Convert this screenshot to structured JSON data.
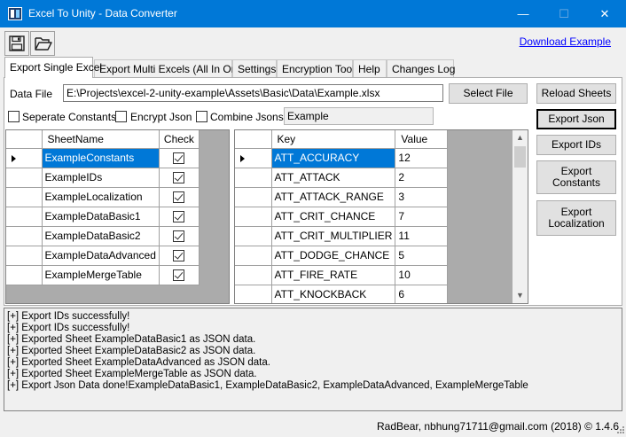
{
  "window": {
    "title": "Excel To Unity - Data Converter",
    "controls": {
      "minimize": "—",
      "maximize": "☐",
      "close": "✕"
    }
  },
  "toolbar": {
    "save_icon": "save-icon",
    "open_icon": "folder-open-icon",
    "download_link": "Download Example"
  },
  "tabs": [
    {
      "label": "Export Single Excel",
      "active": true
    },
    {
      "label": "Export Multi Excels (All In One)"
    },
    {
      "label": "Settings"
    },
    {
      "label": "Encryption Tool"
    },
    {
      "label": "Help"
    },
    {
      "label": "Changes Log"
    }
  ],
  "form": {
    "data_file_label": "Data File",
    "data_file_value": "E:\\Projects\\excel-2-unity-example\\Assets\\Basic\\Data\\Example.xlsx",
    "select_file": "Select File",
    "reload_sheets": "Reload Sheets",
    "separate_constants": "Seperate Constants",
    "encrypt_json": "Encrypt Json",
    "combine_jsons": "Combine Jsons",
    "combine_name": "Example"
  },
  "actions": {
    "export_json": "Export Json",
    "export_ids": "Export IDs",
    "export_constants": "Export\nConstants",
    "export_localization": "Export\nLocalization"
  },
  "sheets": {
    "headers": {
      "name": "SheetName",
      "check": "Check"
    },
    "rows": [
      {
        "name": "ExampleConstants",
        "checked": true,
        "current": true
      },
      {
        "name": "ExampleIDs",
        "checked": true
      },
      {
        "name": "ExampleLocalization",
        "checked": true
      },
      {
        "name": "ExampleDataBasic1",
        "checked": true
      },
      {
        "name": "ExampleDataBasic2",
        "checked": true
      },
      {
        "name": "ExampleDataAdvanced",
        "checked": true
      },
      {
        "name": "ExampleMergeTable",
        "checked": true
      }
    ]
  },
  "keys": {
    "headers": {
      "key": "Key",
      "value": "Value"
    },
    "rows": [
      {
        "key": "ATT_ACCURACY",
        "value": "12",
        "current": true
      },
      {
        "key": "ATT_ATTACK",
        "value": "2"
      },
      {
        "key": "ATT_ATTACK_RANGE",
        "value": "3"
      },
      {
        "key": "ATT_CRIT_CHANCE",
        "value": "7"
      },
      {
        "key": "ATT_CRIT_MULTIPLIER",
        "value": "11"
      },
      {
        "key": "ATT_DODGE_CHANCE",
        "value": "5"
      },
      {
        "key": "ATT_FIRE_RATE",
        "value": "10"
      },
      {
        "key": "ATT_KNOCKBACK",
        "value": "6"
      }
    ]
  },
  "log": [
    "[+] Export IDs successfully!",
    "[+] Export IDs successfully!",
    "[+] Exported Sheet ExampleDataBasic1 as JSON data.",
    "[+] Exported Sheet ExampleDataBasic2 as JSON data.",
    "[+] Exported Sheet ExampleDataAdvanced as JSON data.",
    "[+] Exported Sheet ExampleMergeTable as JSON data.",
    "[+] Export Json Data done!ExampleDataBasic1, ExampleDataBasic2, ExampleDataAdvanced, ExampleMergeTable"
  ],
  "status": "RadBear, nbhung71711@gmail.com (2018) ©   1.4.6",
  "colors": {
    "titlebar": "#0078d7",
    "selection": "#0078d7",
    "link": "#0000ff"
  }
}
